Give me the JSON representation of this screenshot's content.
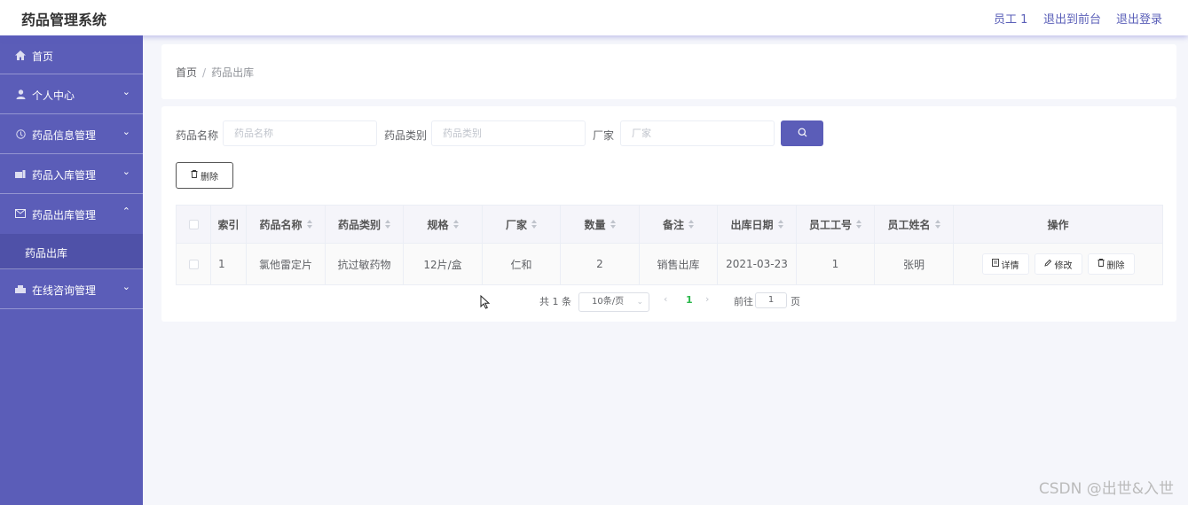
{
  "header": {
    "title": "药品管理系统",
    "user": "员工 1",
    "front": "退出到前台",
    "logout": "退出登录"
  },
  "sidebar": {
    "items": [
      {
        "label": "首页",
        "icon": "home-icon"
      },
      {
        "label": "个人中心",
        "icon": "user-icon"
      },
      {
        "label": "药品信息管理",
        "icon": "info-icon"
      },
      {
        "label": "药品入库管理",
        "icon": "storage-icon"
      },
      {
        "label": "药品出库管理",
        "icon": "mail-icon"
      },
      {
        "label": "在线咨询管理",
        "icon": "chat-icon"
      }
    ],
    "sub_active": "药品出库"
  },
  "breadcrumb": {
    "home": "首页",
    "sep": "/",
    "current": "药品出库"
  },
  "filters": {
    "name_label": "药品名称",
    "name_placeholder": "药品名称",
    "category_label": "药品类别",
    "category_placeholder": "药品类别",
    "maker_label": "厂家",
    "maker_placeholder": "厂家"
  },
  "toolbar": {
    "delete_label": "删除"
  },
  "table": {
    "headers": [
      "索引",
      "药品名称",
      "药品类别",
      "规格",
      "厂家",
      "数量",
      "备注",
      "出库日期",
      "员工工号",
      "员工姓名",
      "操作"
    ],
    "rows": [
      [
        "1",
        "氯他雷定片",
        "抗过敏药物",
        "12片/盒",
        "仁和",
        "2",
        "销售出库",
        "2021-03-23",
        "1",
        "张明"
      ]
    ],
    "actions": {
      "detail": "详情",
      "edit": "修改",
      "delete": "删除"
    }
  },
  "pagination": {
    "total": "共 1 条",
    "page_size": "10条/页",
    "current_page": "1",
    "goto_label": "前往",
    "goto_value": "1",
    "page_unit": "页"
  },
  "watermark": "CSDN @出世&入世",
  "colors": {
    "primary": "#5b5db8",
    "sidebar": "#5b5db8",
    "active_page": "#2db84d"
  }
}
